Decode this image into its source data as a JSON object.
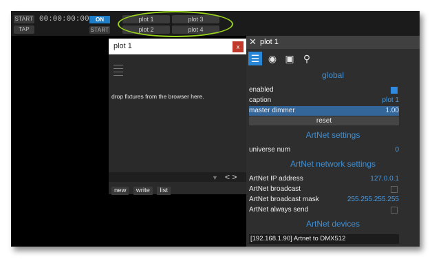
{
  "topbar": {
    "start_label": "START",
    "tap_label": "TAP",
    "timecode": "00:00:00:00",
    "on_label": "ON",
    "start2_label": "START",
    "plots": [
      "plot 1",
      "plot 3",
      "plot 2",
      "plot 4"
    ]
  },
  "plot_window": {
    "title": "plot 1",
    "close_label": "x",
    "drop_text": "drop fixtures from the browser here.",
    "footer": [
      "new",
      "write",
      "list"
    ]
  },
  "panel": {
    "title": "plot 1",
    "sections": {
      "global": "global",
      "artnet_settings": "ArtNet settings",
      "artnet_network": "ArtNet network settings",
      "artnet_devices": "ArtNet devices"
    },
    "enabled_label": "enabled",
    "enabled": true,
    "caption_label": "caption",
    "caption_value": "plot 1",
    "master_dimmer_label": "master dimmer",
    "master_dimmer_value": "1.00",
    "reset_label": "reset",
    "universe_label": "universe num",
    "universe_value": "0",
    "ip_label": "ArtNet IP address",
    "ip_value": "127.0.0.1",
    "broadcast_label": "ArtNet broadcast",
    "broadcast_addr_label": "ArtNet broadcast mask",
    "broadcast_addr_value": "255.255.255.255",
    "always_send_label": "ArtNet always send",
    "device": "[192.168.1.90] Artnet to DMX512"
  },
  "colors": {
    "accent": "#2a86d6",
    "highlight_ellipse": "#9ad41c",
    "close_red": "#c0392b"
  }
}
